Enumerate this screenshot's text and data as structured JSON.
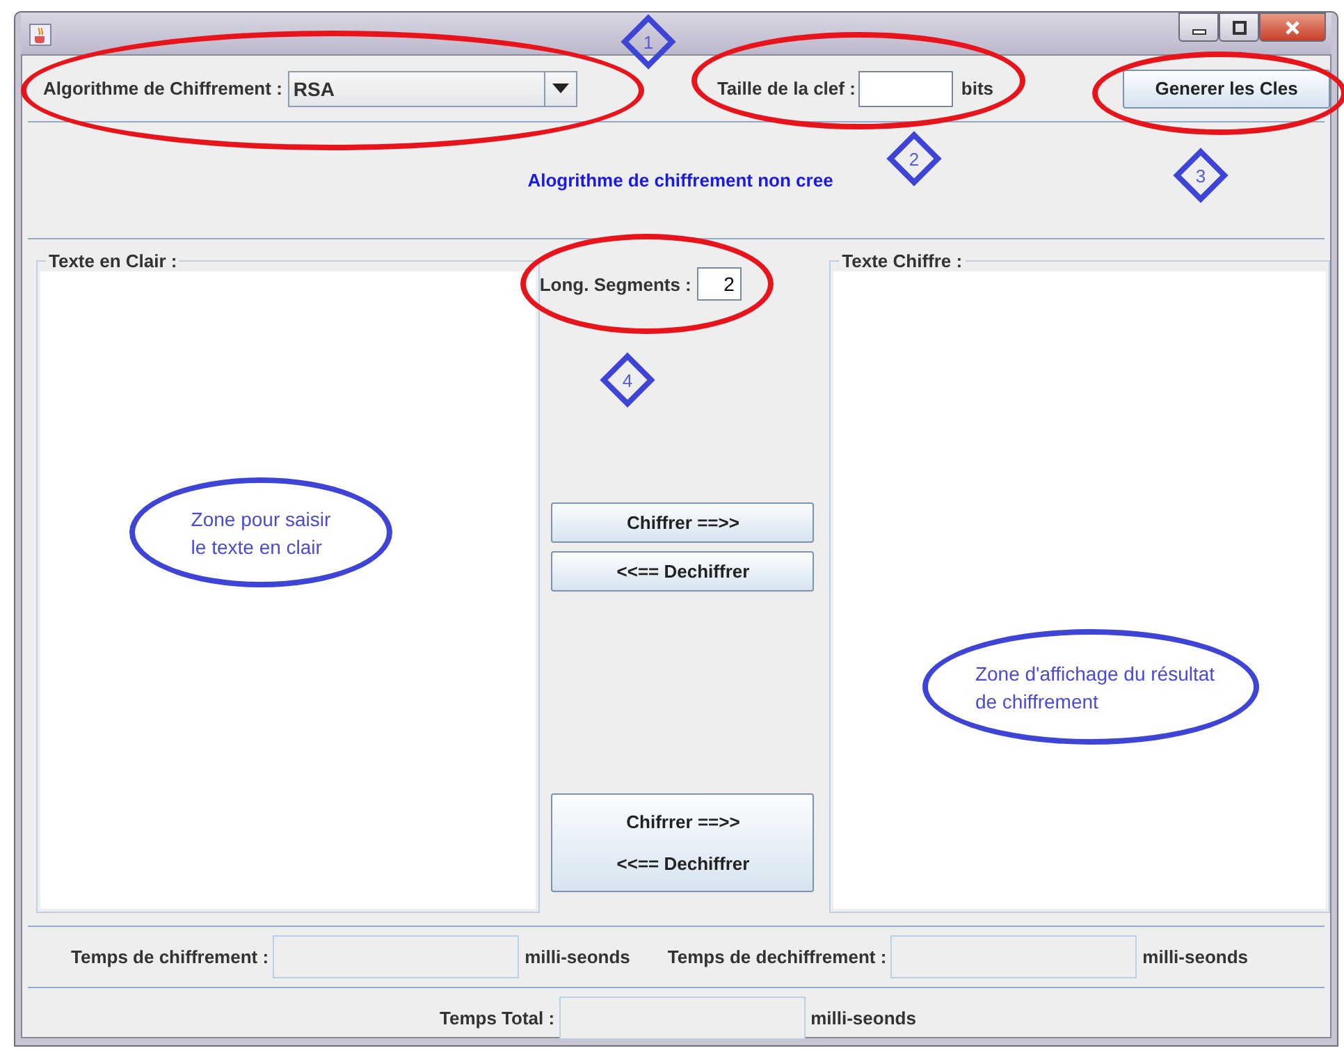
{
  "algorithm": {
    "label": "Algorithme de Chiffrement :",
    "value": "RSA"
  },
  "key_size": {
    "label": "Taille de la clef :",
    "unit": "bits"
  },
  "generate_button": "Generer les Cles",
  "status_message": "Alogrithme de chiffrement non cree",
  "plain_text": {
    "title": "Texte en Clair :"
  },
  "segment_length": {
    "label": "Long. Segments :",
    "value": "2"
  },
  "buttons": [
    "Chiffrer  ==>>",
    "<<==  Dechiffrer"
  ],
  "combined_button": {
    "lines": [
      "Chifrrer ==>>",
      "<<== Dechiffrer"
    ]
  },
  "cipher_text": {
    "title": "Texte Chiffre :"
  },
  "timings": [
    {
      "label": "Temps de chiffrement :",
      "unit": "milli-seonds"
    },
    {
      "label": "Temps de dechiffrement :",
      "unit": "milli-seonds"
    }
  ],
  "total": {
    "label": "Temps Total :",
    "unit": "milli-seonds"
  },
  "annotations": {
    "markers": [
      "1",
      "2",
      "3",
      "4"
    ],
    "notes": [
      {
        "lines": [
          "Zone pour saisir",
          "le texte en clair"
        ]
      },
      {
        "lines": [
          "Zone d'affichage du résultat",
          "de chiffrement"
        ]
      }
    ]
  }
}
